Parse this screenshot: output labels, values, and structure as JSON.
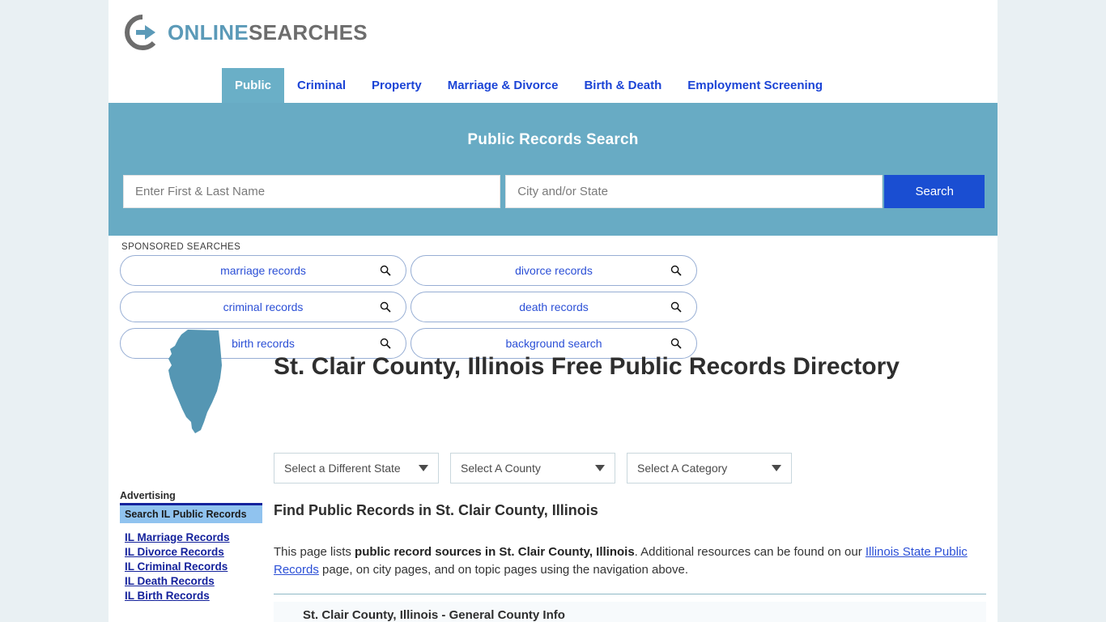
{
  "brand": {
    "word1": "ONLINE",
    "word2": "SEARCHES",
    "logo_icon": "circular-arrow-icon",
    "color_primary": "#5b9ab8",
    "color_secondary": "#6d6d6d"
  },
  "nav": {
    "items": [
      {
        "label": "Public",
        "active": true
      },
      {
        "label": "Criminal",
        "active": false
      },
      {
        "label": "Property",
        "active": false
      },
      {
        "label": "Marriage & Divorce",
        "active": false
      },
      {
        "label": "Birth & Death",
        "active": false
      },
      {
        "label": "Employment Screening",
        "active": false
      }
    ],
    "active_bg": "#6aafc7",
    "link_color": "#1b44d6"
  },
  "search": {
    "title": "Public Records Search",
    "name_placeholder": "Enter First & Last Name",
    "name_value": "",
    "city_placeholder": "City and/or State",
    "city_value": "",
    "button_label": "Search",
    "band_color": "#68abc4",
    "button_color": "#1a4ed2"
  },
  "sponsored": {
    "label": "SPONSORED SEARCHES",
    "items": [
      {
        "label": "marriage records",
        "icon": "search-icon"
      },
      {
        "label": "divorce records",
        "icon": "search-icon"
      },
      {
        "label": "criminal records",
        "icon": "search-icon"
      },
      {
        "label": "death records",
        "icon": "search-icon"
      },
      {
        "label": "birth records",
        "icon": "search-icon"
      },
      {
        "label": "background search",
        "icon": "search-icon"
      }
    ]
  },
  "hero": {
    "map_icon": "illinois-state-map-icon",
    "map_color": "#5596b3",
    "title": "St. Clair County, Illinois Free Public Records Directory"
  },
  "selectors": [
    {
      "label": "Select a Different State",
      "name": "state-select"
    },
    {
      "label": "Select A County",
      "name": "county-select"
    },
    {
      "label": "Select A Category",
      "name": "category-select"
    }
  ],
  "advertising": {
    "label": "Advertising",
    "header": "Search IL Public Records",
    "links": [
      "IL Marriage Records",
      "IL Divorce Records",
      "IL Criminal Records",
      "IL Death Records",
      "IL Birth Records"
    ]
  },
  "main": {
    "heading": "Find Public Records in St. Clair County, Illinois",
    "paragraph": {
      "part1": "This page lists ",
      "bold1": "public record sources in St. Clair County, Illinois",
      "part2": ". Additional resources can be found on our ",
      "link1": "Illinois State Public Records",
      "part3": " page, on city pages, and on topic pages using the navigation above."
    },
    "section_heading": "St. Clair County, Illinois - General County Info"
  }
}
